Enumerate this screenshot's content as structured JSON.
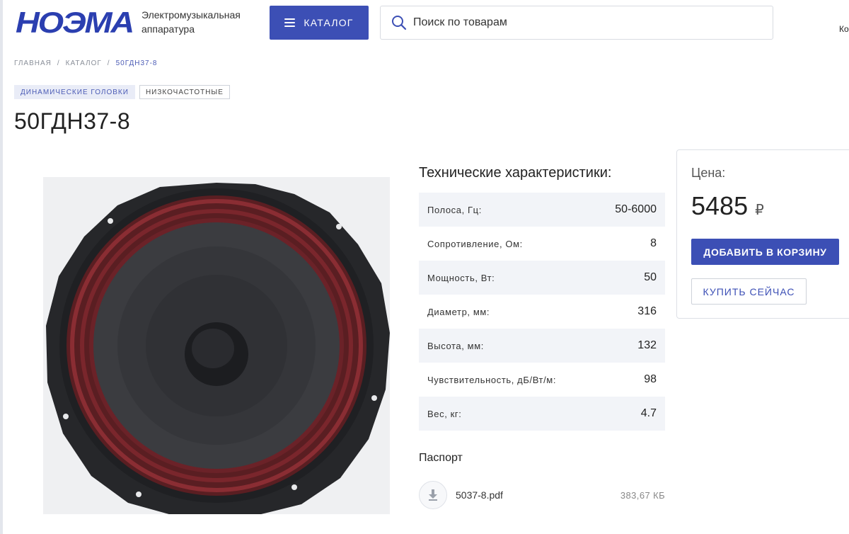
{
  "header": {
    "logo_text": "НОЭМА",
    "tagline": "Электромузыкальная аппаратура",
    "catalog_label": "КАТАЛОГ",
    "search_placeholder": "Поиск по товарам",
    "cut_text": "Ко"
  },
  "breadcrumb": {
    "items": [
      "ГЛАВНАЯ",
      "КАТАЛОГ",
      "50ГДН37-8"
    ],
    "separator": "/"
  },
  "tags": [
    "ДИНАМИЧЕСКИЕ ГОЛОВКИ",
    "НИЗКОЧАСТОТНЫЕ"
  ],
  "product": {
    "title": "50ГДН37-8"
  },
  "specs": {
    "title": "Технические характеристики:",
    "rows": [
      {
        "label": "Полоса, Гц:",
        "value": "50-6000"
      },
      {
        "label": "Сопротивление, Ом:",
        "value": "8"
      },
      {
        "label": "Мощность, Вт:",
        "value": "50"
      },
      {
        "label": "Диаметр, мм:",
        "value": "316"
      },
      {
        "label": "Высота, мм:",
        "value": "132"
      },
      {
        "label": "Чувствительность, дБ/Вт/м:",
        "value": "98"
      },
      {
        "label": "Вес, кг:",
        "value": "4.7"
      }
    ]
  },
  "passport": {
    "title": "Паспорт",
    "file_name": "5037-8.pdf",
    "file_size": "383,67 КБ"
  },
  "price": {
    "label": "Цена:",
    "value": "5485",
    "currency": "₽",
    "add_to_cart": "ДОБАВИТЬ В КОРЗИНУ",
    "buy_now": "КУПИТЬ СЕЙЧАС"
  },
  "colors": {
    "accent": "#3c4fb5",
    "row_bg": "#f2f4f8"
  }
}
